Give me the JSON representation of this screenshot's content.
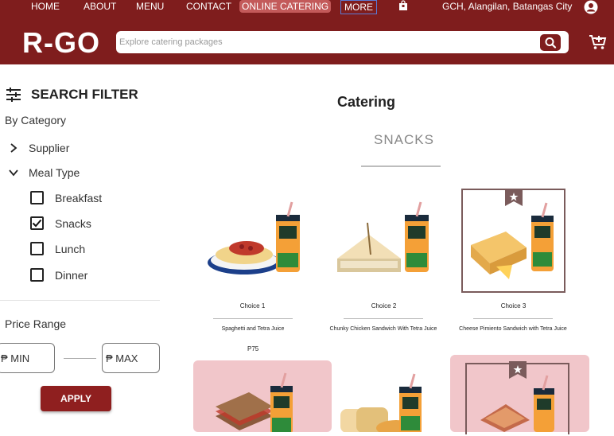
{
  "topnav": {
    "home": "HOME",
    "about": "ABOUT",
    "menu": "MENU",
    "contact": "CONTACT",
    "online_catering": "ONLINE CATERING",
    "more": "MORE",
    "location": "GCH, Alangilan, Batangas City"
  },
  "header": {
    "logo": "R-GO",
    "search_placeholder": "Explore catering packages"
  },
  "filter": {
    "title": "SEARCH FILTER",
    "by_category": "By Category",
    "supplier": "Supplier",
    "meal_type": "Meal Type",
    "meal_options": [
      {
        "label": "Breakfast",
        "checked": false
      },
      {
        "label": "Snacks",
        "checked": true
      },
      {
        "label": "Lunch",
        "checked": false
      },
      {
        "label": "Dinner",
        "checked": false
      }
    ],
    "price_range": "Price Range",
    "min": "₱ MIN",
    "max": "₱ MAX",
    "apply": "APPLY"
  },
  "main": {
    "title": "Catering",
    "subtitle": "SNACKS",
    "items": [
      {
        "choice": "Choice 1",
        "desc": "Spaghetti and Tetra Juice",
        "price": "P75"
      },
      {
        "choice": "Choice 2",
        "desc": "Chunky Chicken Sandwich With Tetra Juice",
        "price": ""
      },
      {
        "choice": "Choice 3",
        "desc": "Cheese Pimiento Sandwich with Tetra Juice",
        "price": ""
      }
    ]
  },
  "colors": {
    "brand": "#7f1d1d",
    "accent": "#8f1f1f",
    "card_pink": "#f1c6ca"
  }
}
